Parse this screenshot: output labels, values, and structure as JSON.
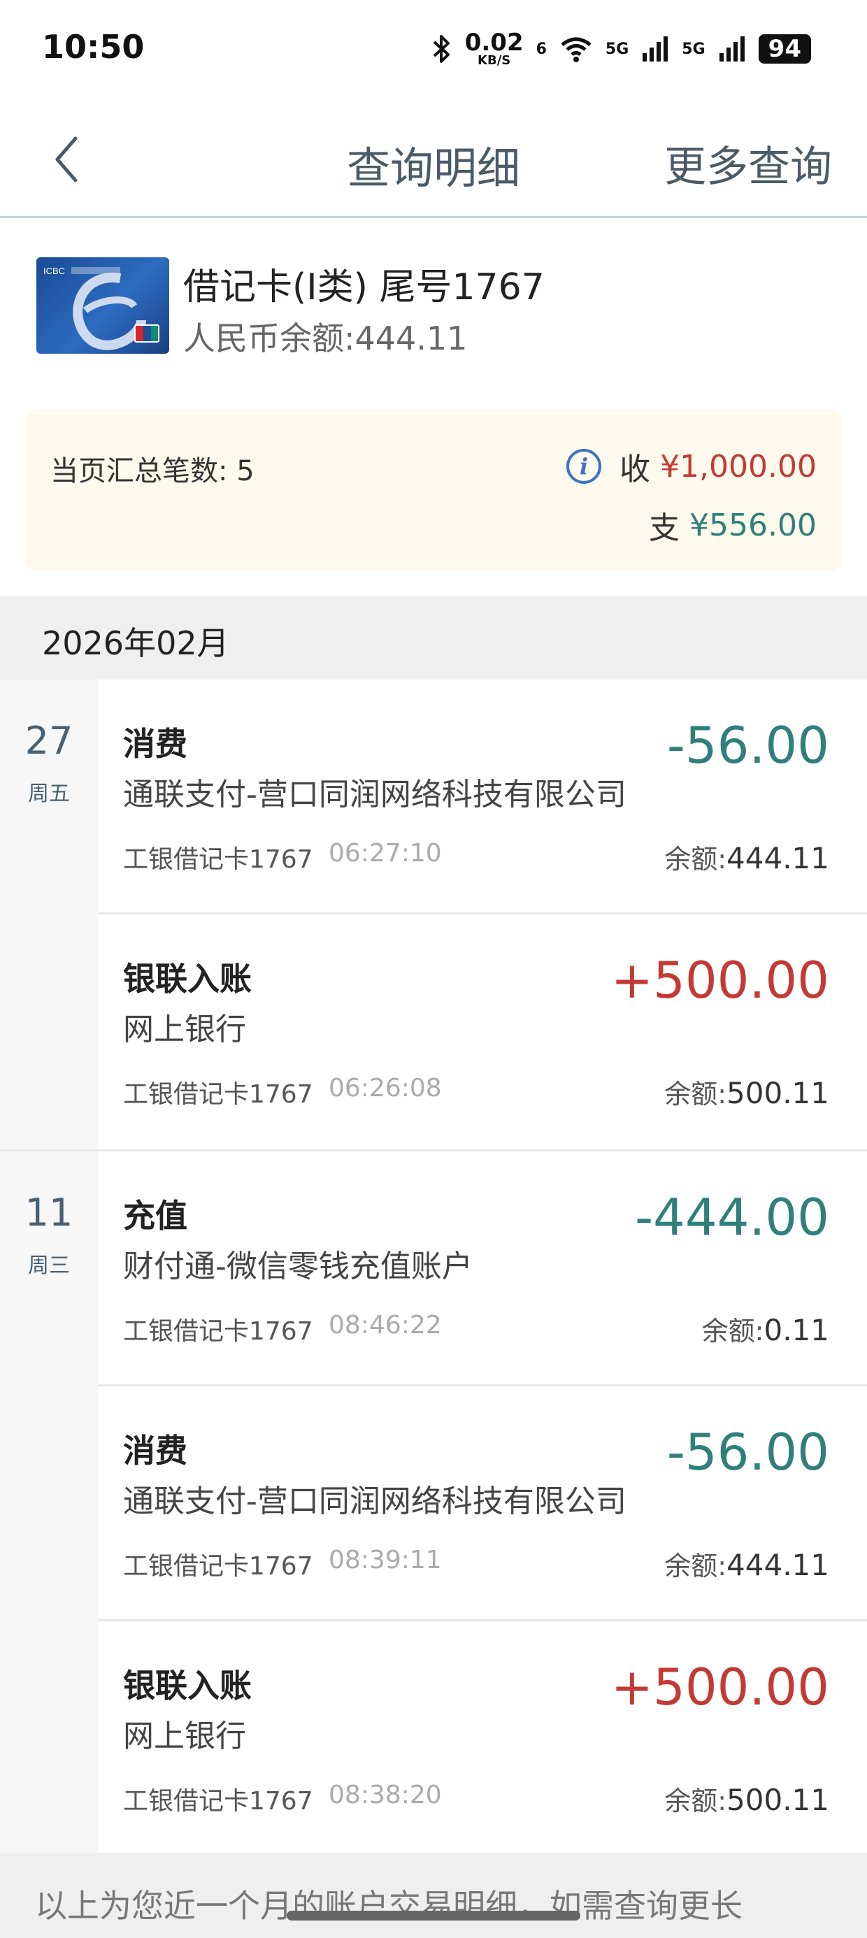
{
  "status_bar": {
    "time": "10:50",
    "speed_value": "0.02",
    "speed_unit": "KB/S",
    "wifi_label": "6",
    "net1": "5G",
    "net2": "5G",
    "battery": "94"
  },
  "nav": {
    "back_icon": "chevron-left-icon",
    "title": "查询明细",
    "more": "更多查询"
  },
  "account": {
    "card_brand": "ICBC",
    "card_name": "借记卡(I类) 尾号1767",
    "balance": "人民币余额:444.11"
  },
  "summary": {
    "count_label": "当页汇总笔数: 5",
    "income_label": "收",
    "income_value": "¥1,000.00",
    "expense_label": "支",
    "expense_value": "¥556.00",
    "info_icon": "info-icon"
  },
  "month": "2026年02月",
  "groups": [
    {
      "day": "27",
      "weekday": "周五"
    },
    {
      "day": "11",
      "weekday": "周三"
    }
  ],
  "transactions": [
    {
      "type": "消费",
      "desc": "通联支付-营口同润网络科技有限公司",
      "card": "工银借记卡1767",
      "time": "06:27:10",
      "amount": "-56.00",
      "balance_label": "余额:",
      "balance": "444.11",
      "direction": "out"
    },
    {
      "type": "银联入账",
      "desc": "网上银行",
      "card": "工银借记卡1767",
      "time": "06:26:08",
      "amount": "+500.00",
      "balance_label": "余额:",
      "balance": "500.11",
      "direction": "in"
    },
    {
      "type": "充值",
      "desc": "财付通-微信零钱充值账户",
      "card": "工银借记卡1767",
      "time": "08:46:22",
      "amount": "-444.00",
      "balance_label": "余额:",
      "balance": "0.11",
      "direction": "out"
    },
    {
      "type": "消费",
      "desc": "通联支付-营口同润网络科技有限公司",
      "card": "工银借记卡1767",
      "time": "08:39:11",
      "amount": "-56.00",
      "balance_label": "余额:",
      "balance": "444.11",
      "direction": "out"
    },
    {
      "type": "银联入账",
      "desc": "网上银行",
      "card": "工银借记卡1767",
      "time": "08:38:20",
      "amount": "+500.00",
      "balance_label": "余额:",
      "balance": "500.11",
      "direction": "in"
    }
  ],
  "footer_text": "以上为您近一个月的账户交易明细，如需查询更长",
  "colors": {
    "income": "#c33a35",
    "expense": "#2f7f7b",
    "accent": "#3f72c4"
  }
}
